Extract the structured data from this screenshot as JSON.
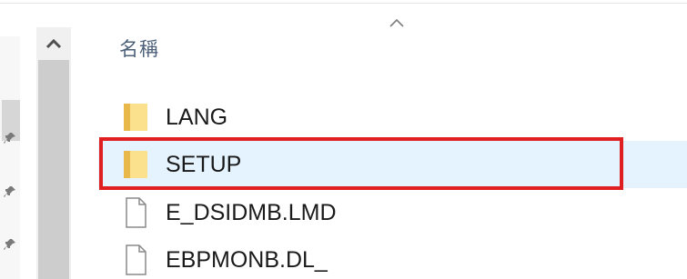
{
  "header": {
    "name_column": "名稱"
  },
  "files": [
    {
      "name": "LANG",
      "type": "folder",
      "icon": "folder-icon",
      "selected": false
    },
    {
      "name": "SETUP",
      "type": "folder",
      "icon": "folder-icon",
      "selected": true
    },
    {
      "name": "E_DSIDMB.LMD",
      "type": "file",
      "icon": "file-icon",
      "selected": false
    },
    {
      "name": "EBPMONB.DL_",
      "type": "file",
      "icon": "file-icon",
      "selected": false
    }
  ],
  "colors": {
    "folder": "#f8d775",
    "selection": "#e5f3ff",
    "highlight": "#e02020",
    "header_text": "#4c607a"
  }
}
